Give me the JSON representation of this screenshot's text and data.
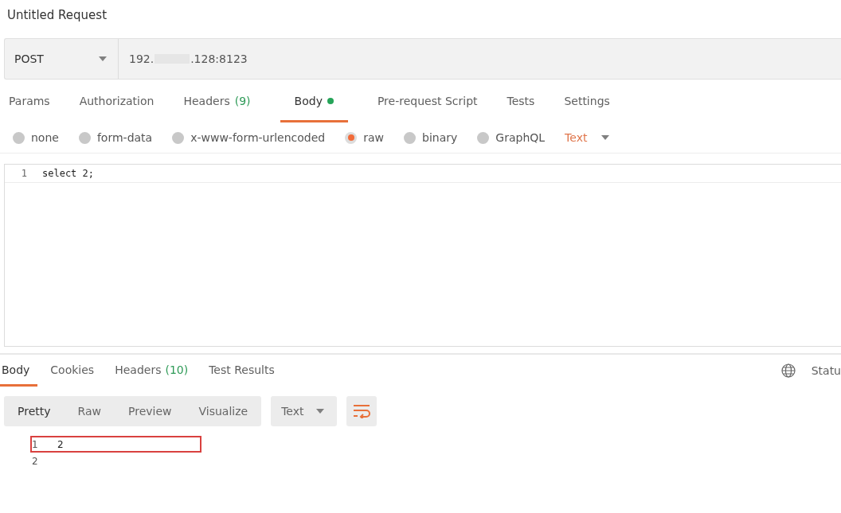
{
  "request_title": "Untitled Request",
  "method": "POST",
  "url": {
    "start": "192.",
    "end": ".128:8123"
  },
  "request_tabs": [
    {
      "label": "Params",
      "selected": false,
      "dot": false
    },
    {
      "label": "Authorization",
      "selected": false,
      "dot": false
    },
    {
      "label": "Headers",
      "count": "(9)",
      "selected": false,
      "dot": false
    },
    {
      "label": "Body",
      "selected": true,
      "dot": true
    },
    {
      "label": "Pre-request Script",
      "selected": false,
      "dot": false
    },
    {
      "label": "Tests",
      "selected": false,
      "dot": false
    },
    {
      "label": "Settings",
      "selected": false,
      "dot": false
    }
  ],
  "body_types": [
    {
      "label": "none",
      "selected": false
    },
    {
      "label": "form-data",
      "selected": false
    },
    {
      "label": "x-www-form-urlencoded",
      "selected": false
    },
    {
      "label": "raw",
      "selected": true
    },
    {
      "label": "binary",
      "selected": false
    },
    {
      "label": "GraphQL",
      "selected": false
    }
  ],
  "raw_format": "Text",
  "editor_lines": [
    {
      "number": "1",
      "code": "select 2;"
    }
  ],
  "response_tabs": [
    {
      "label": "Body",
      "selected": true
    },
    {
      "label": "Cookies",
      "selected": false
    },
    {
      "label": "Headers",
      "count": "(10)",
      "selected": false
    },
    {
      "label": "Test Results",
      "selected": false
    }
  ],
  "status_label": "Statu",
  "view_modes": [
    {
      "label": "Pretty",
      "selected": true
    },
    {
      "label": "Raw",
      "selected": false
    },
    {
      "label": "Preview",
      "selected": false
    },
    {
      "label": "Visualize",
      "selected": false
    }
  ],
  "response_format": "Text",
  "response_lines": [
    {
      "number": "1",
      "text": "2",
      "highlighted": true
    },
    {
      "number": "2",
      "highlighted": false
    }
  ]
}
